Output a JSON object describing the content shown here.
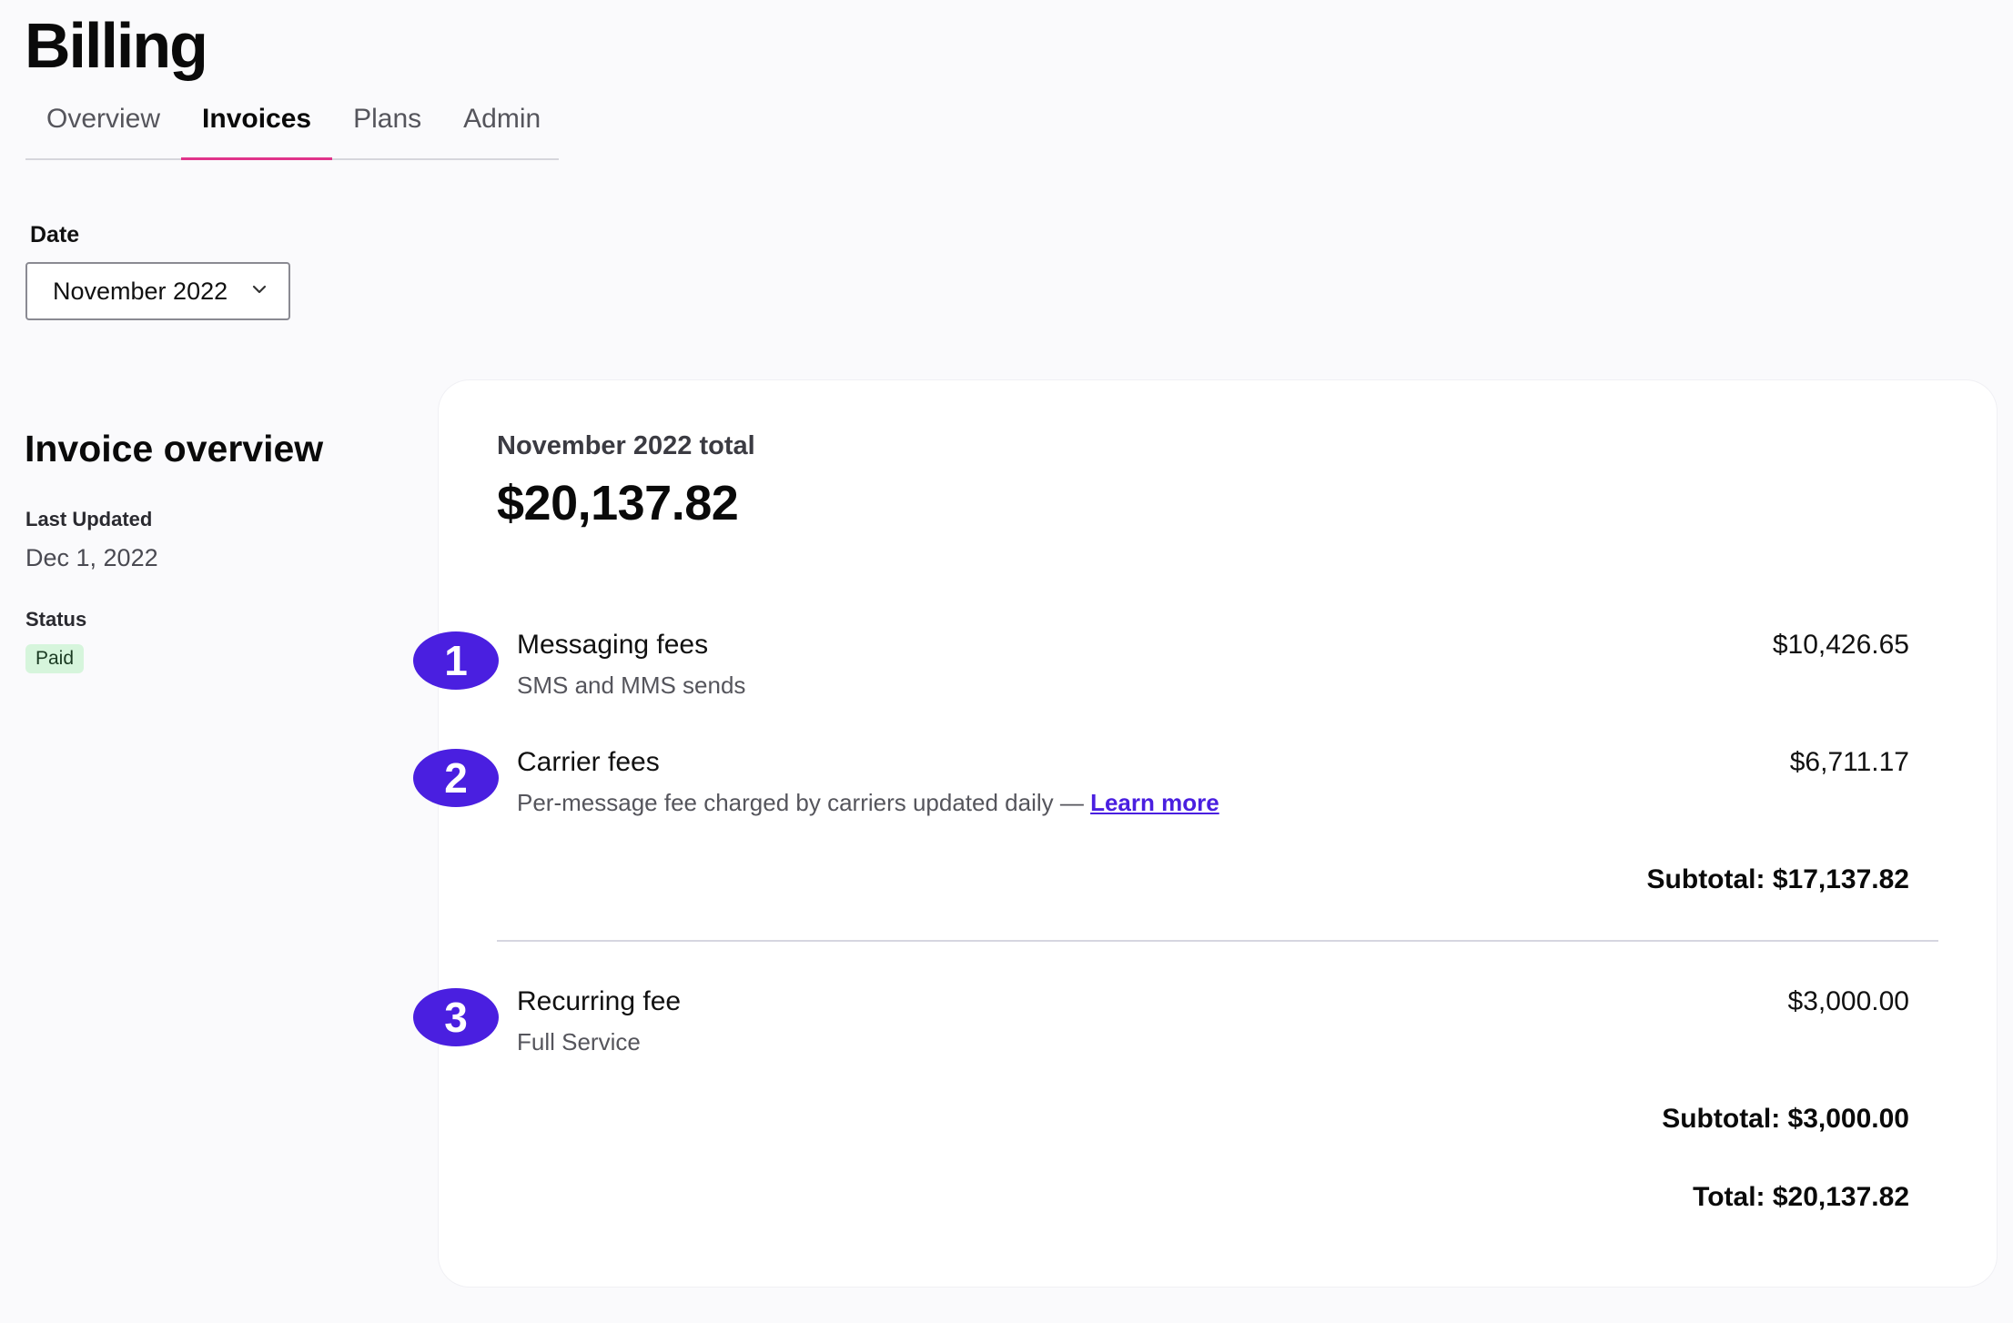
{
  "page": {
    "title": "Billing"
  },
  "tabs": [
    {
      "label": "Overview",
      "active": false
    },
    {
      "label": "Invoices",
      "active": true
    },
    {
      "label": "Plans",
      "active": false
    },
    {
      "label": "Admin",
      "active": false
    }
  ],
  "date_filter": {
    "label": "Date",
    "selected": "November 2022",
    "icon": "chevron-down-icon"
  },
  "overview": {
    "heading": "Invoice overview",
    "last_updated_label": "Last Updated",
    "last_updated_value": "Dec 1, 2022",
    "status_label": "Status",
    "status_value": "Paid"
  },
  "invoice": {
    "period_label": "November 2022 total",
    "total_amount": "$20,137.82",
    "items": [
      {
        "number": "1",
        "name": "Messaging fees",
        "description": "SMS and MMS sends",
        "amount": "$10,426.65"
      },
      {
        "number": "2",
        "name": "Carrier fees",
        "description": "Per-message fee charged by carriers updated daily — ",
        "link_text": "Learn more",
        "amount": "$6,711.17"
      },
      {
        "number": "3",
        "name": "Recurring fee",
        "description": "Full Service",
        "amount": "$3,000.00"
      }
    ],
    "subtotal_1": "Subtotal: $17,137.82",
    "subtotal_2": "Subtotal: $3,000.00",
    "total_line": "Total: $20,137.82"
  },
  "colors": {
    "accent": "#4a1fe0",
    "tab_indicator": "#e0338a",
    "status_paid_bg": "#d6f5dc",
    "background": "#fafafc"
  }
}
